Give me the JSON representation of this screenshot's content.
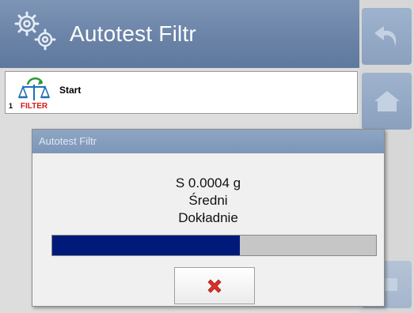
{
  "header": {
    "title": "Autotest Filtr",
    "icon": "gear-icon"
  },
  "side_buttons": [
    {
      "icon": "undo-arrow-icon"
    },
    {
      "icon": "home-icon"
    },
    {
      "icon": "side-button-icon"
    }
  ],
  "list": {
    "items": [
      {
        "number": "1",
        "label": "Start",
        "icon": "balance-filter-icon",
        "icon_text": "FILTER"
      }
    ]
  },
  "dialog": {
    "title": "Autotest Filtr",
    "line1": "S 0.0004 g",
    "line2": "Średni",
    "line3": "Dokładnie",
    "progress": 0.58,
    "cancel_icon": "close-x-icon"
  },
  "colors": {
    "header": "#6f88ab",
    "progress_fill": "#001a7a",
    "cancel_x": "#d9302a",
    "filter_text": "#d61a1a"
  }
}
